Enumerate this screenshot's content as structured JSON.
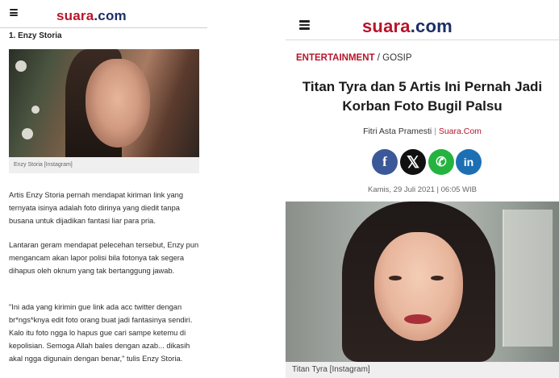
{
  "left_panel": {
    "logo": {
      "brand": "suara",
      "tld": ".com"
    },
    "section_title": "1. Enzy Storia",
    "image_caption": "Enzy Storia [Instagram]",
    "paragraphs": [
      "Artis Enzy Storia pernah mendapat kiriman link yang ternyata isinya adalah foto dirinya yang diedit tanpa busana untuk dijadikan fantasi liar para pria.",
      "Lantaran geram mendapat pelecehan tersebut, Enzy pun mengancam akan lapor polisi bila fotonya tak segera dihapus oleh oknum yang tak bertanggung jawab.",
      "\"Ini ada yang kirimin gue link ada acc twitter dengan br*ngs*knya edit foto orang buat jadi fantasinya sendiri. Kalo itu foto ngga lo hapus gue cari sampe ketemu di kepolisian. Semoga Allah bales dengan azab... dikasih akal ngga digunain dengan benar,\" tulis Enzy Storia."
    ]
  },
  "right_panel": {
    "logo": {
      "brand": "suara",
      "tld": ".com"
    },
    "breadcrumb": {
      "category": "ENTERTAINMENT",
      "separator": " / ",
      "subcategory": "GOSIP"
    },
    "title": "Titan Tyra dan 5 Artis Ini Pernah Jadi Korban Foto Bugil Palsu",
    "author": {
      "name": "Fitri Asta Pramesti",
      "separator": " | ",
      "site": "Suara.Com"
    },
    "share_buttons": [
      {
        "name": "facebook",
        "glyph": "f",
        "icon": "facebook-icon",
        "color": "#3b5998"
      },
      {
        "name": "x",
        "glyph": "𝕏",
        "icon": "x-icon",
        "color": "#111111"
      },
      {
        "name": "whatsapp",
        "glyph": "✆",
        "icon": "whatsapp-icon",
        "color": "#25b33f"
      },
      {
        "name": "linkedin",
        "glyph": "in",
        "icon": "linkedin-icon",
        "color": "#1d6fb4"
      }
    ],
    "date": "Kamis, 29 Juli 2021 | 06:05 WIB",
    "image_caption": "Titan Tyra [Instagram]"
  },
  "colors": {
    "brand_red": "#b6152b",
    "brand_navy": "#1c2f66"
  }
}
